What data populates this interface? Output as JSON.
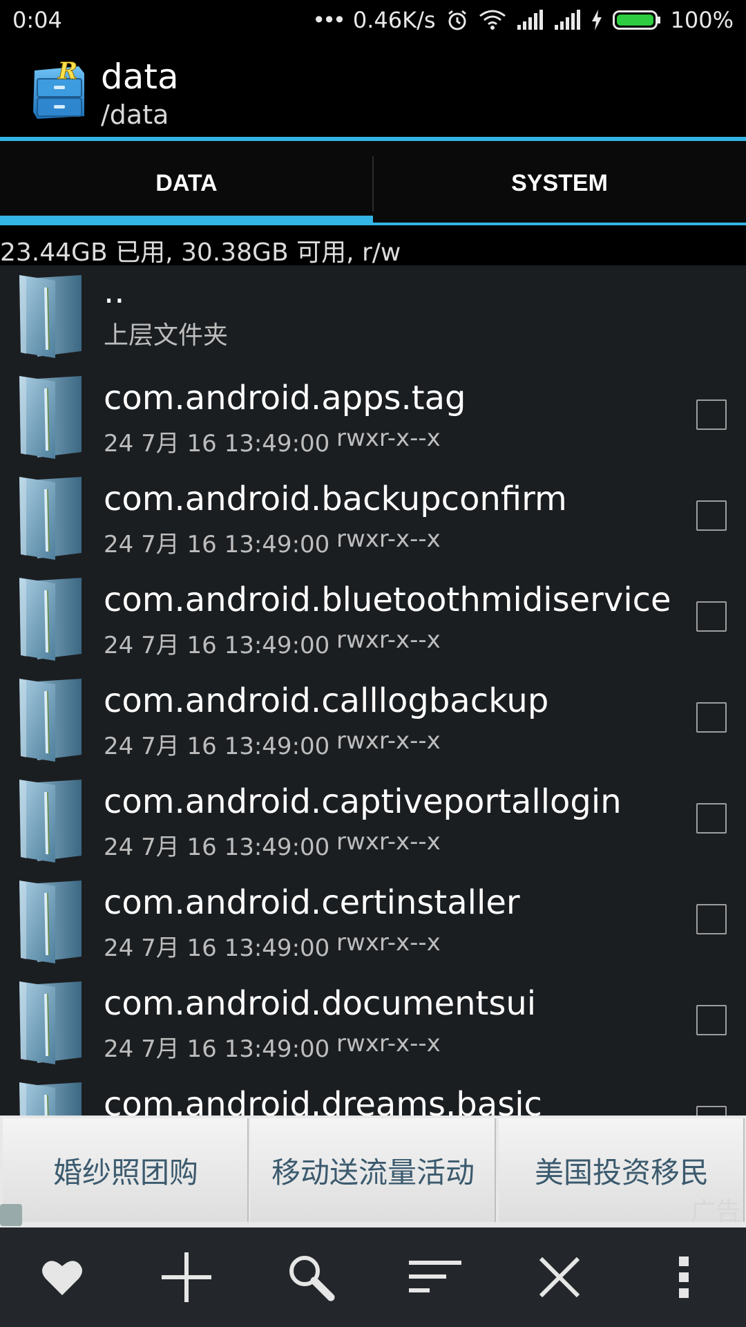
{
  "status": {
    "time": "0:04",
    "dots": "•••",
    "speed": "0.46K/s",
    "battery": "100%",
    "battery_color": "#2ecc40"
  },
  "header": {
    "title": "data",
    "path": "/data",
    "app_icon": "root-explorer-icon"
  },
  "tabs": [
    {
      "label": "DATA",
      "active": true
    },
    {
      "label": "SYSTEM",
      "active": false
    }
  ],
  "storage": "23.44GB 已用, 30.38GB 可用, r/w",
  "parent": {
    "name": "..",
    "subtitle": "上层文件夹"
  },
  "files": [
    {
      "name": "com.android.apps.tag",
      "date": "24 7月 16 13:49:00",
      "perm": "rwxr-x--x"
    },
    {
      "name": "com.android.backupconfirm",
      "date": "24 7月 16 13:49:00",
      "perm": "rwxr-x--x"
    },
    {
      "name": "com.android.bluetoothmidiservice",
      "date": "24 7月 16 13:49:00",
      "perm": "rwxr-x--x"
    },
    {
      "name": "com.android.calllogbackup",
      "date": "24 7月 16 13:49:00",
      "perm": "rwxr-x--x"
    },
    {
      "name": "com.android.captiveportallogin",
      "date": "24 7月 16 13:49:00",
      "perm": "rwxr-x--x"
    },
    {
      "name": "com.android.certinstaller",
      "date": "24 7月 16 13:49:00",
      "perm": "rwxr-x--x"
    },
    {
      "name": "com.android.documentsui",
      "date": "24 7月 16 13:49:00",
      "perm": "rwxr-x--x"
    },
    {
      "name": "com.android.dreams.basic",
      "date": "",
      "perm": ""
    }
  ],
  "ads": {
    "items": [
      "婚纱照团购",
      "移动送流量活动",
      "美国投资移民"
    ],
    "label": "广告"
  },
  "toolbar": {
    "icons": [
      "heart-icon",
      "plus-icon",
      "search-icon",
      "sort-icon",
      "close-icon",
      "overflow-menu-icon"
    ]
  },
  "colors": {
    "accent": "#33b5e5",
    "list_bg": "#1b1e21",
    "toolbar_bg": "#23272b"
  }
}
